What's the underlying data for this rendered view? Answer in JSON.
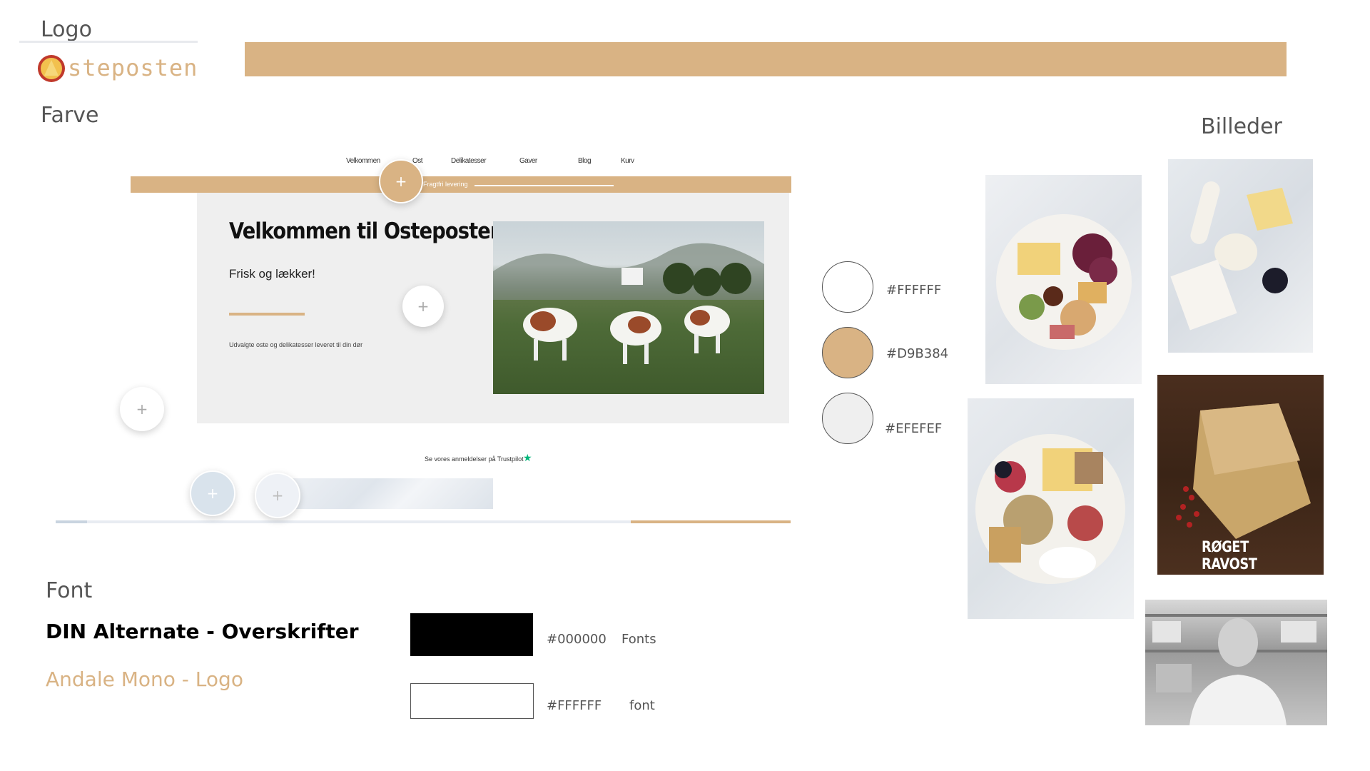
{
  "sections": {
    "logo": "Logo",
    "color": "Farve",
    "images": "Billeder",
    "font": "Font"
  },
  "logo": {
    "text": "steposten"
  },
  "colors": {
    "accent": "#D9B384",
    "light_gray": "#EFEFEF",
    "white": "#FFFFFF",
    "black": "#000000",
    "swatch_labels": [
      "#FFFFFF",
      "#D9B384",
      "#EFEFEF"
    ]
  },
  "mockup": {
    "nav": [
      "Velkommen",
      "Ost",
      "Delikatesser",
      "Gaver",
      "Blog",
      "Kurv"
    ],
    "banner_text": "Fragtfri levering",
    "hero_title": "Velkommen til Osteposten",
    "hero_subtitle": "Frisk og lækker!",
    "hero_body": "Udvalgte oste og delikatesser leveret til din dør",
    "review_text": "Se vores anmeldelser på Trustpilot",
    "plus": "+"
  },
  "fonts": {
    "heading_sample": "DIN Alternate - Overskrifter",
    "logo_sample": "Andale Mono - Logo",
    "swatches": [
      {
        "hex": "#000000",
        "label": "Fonts"
      },
      {
        "hex": "#FFFFFF",
        "label": "font"
      }
    ]
  },
  "photos": {
    "smoked_cheese_label": "RØGET RAVOST"
  }
}
